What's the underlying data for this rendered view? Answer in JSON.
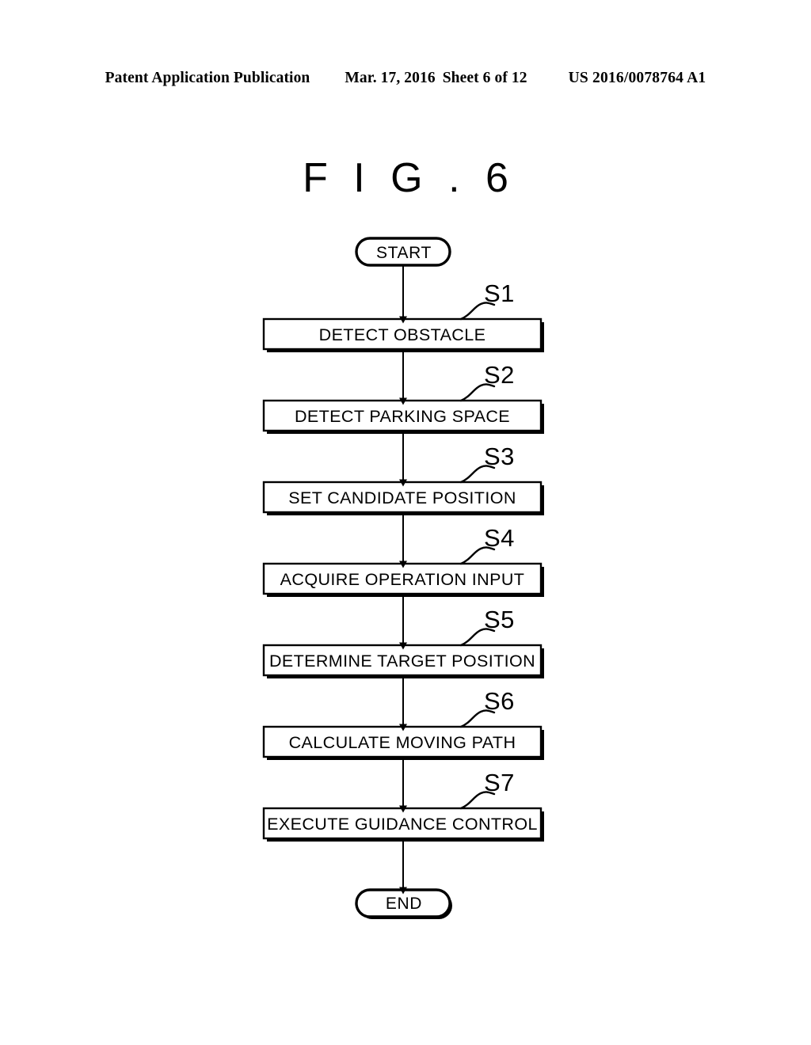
{
  "page": {
    "header": {
      "publication": "Patent Application Publication",
      "date": "Mar. 17, 2016",
      "sheet": "Sheet 6 of 12",
      "patent_number": "US 2016/0078764 A1"
    },
    "figure_title": "F I G . 6",
    "ink_color": "#000000",
    "background_color": "#ffffff"
  },
  "flowchart": {
    "start_node": {
      "label": "START",
      "shape": "rounded-terminator"
    },
    "end_node": {
      "label": "END",
      "shape": "rounded-terminator"
    },
    "steps": [
      {
        "ref": "S1",
        "label": "DETECT OBSTACLE"
      },
      {
        "ref": "S2",
        "label": "DETECT PARKING SPACE"
      },
      {
        "ref": "S3",
        "label": "SET CANDIDATE POSITION"
      },
      {
        "ref": "S4",
        "label": "ACQUIRE OPERATION INPUT"
      },
      {
        "ref": "S5",
        "label": "DETERMINE TARGET POSITION"
      },
      {
        "ref": "S6",
        "label": "CALCULATE MOVING PATH"
      },
      {
        "ref": "S7",
        "label": "EXECUTE GUIDANCE CONTROL"
      }
    ]
  }
}
